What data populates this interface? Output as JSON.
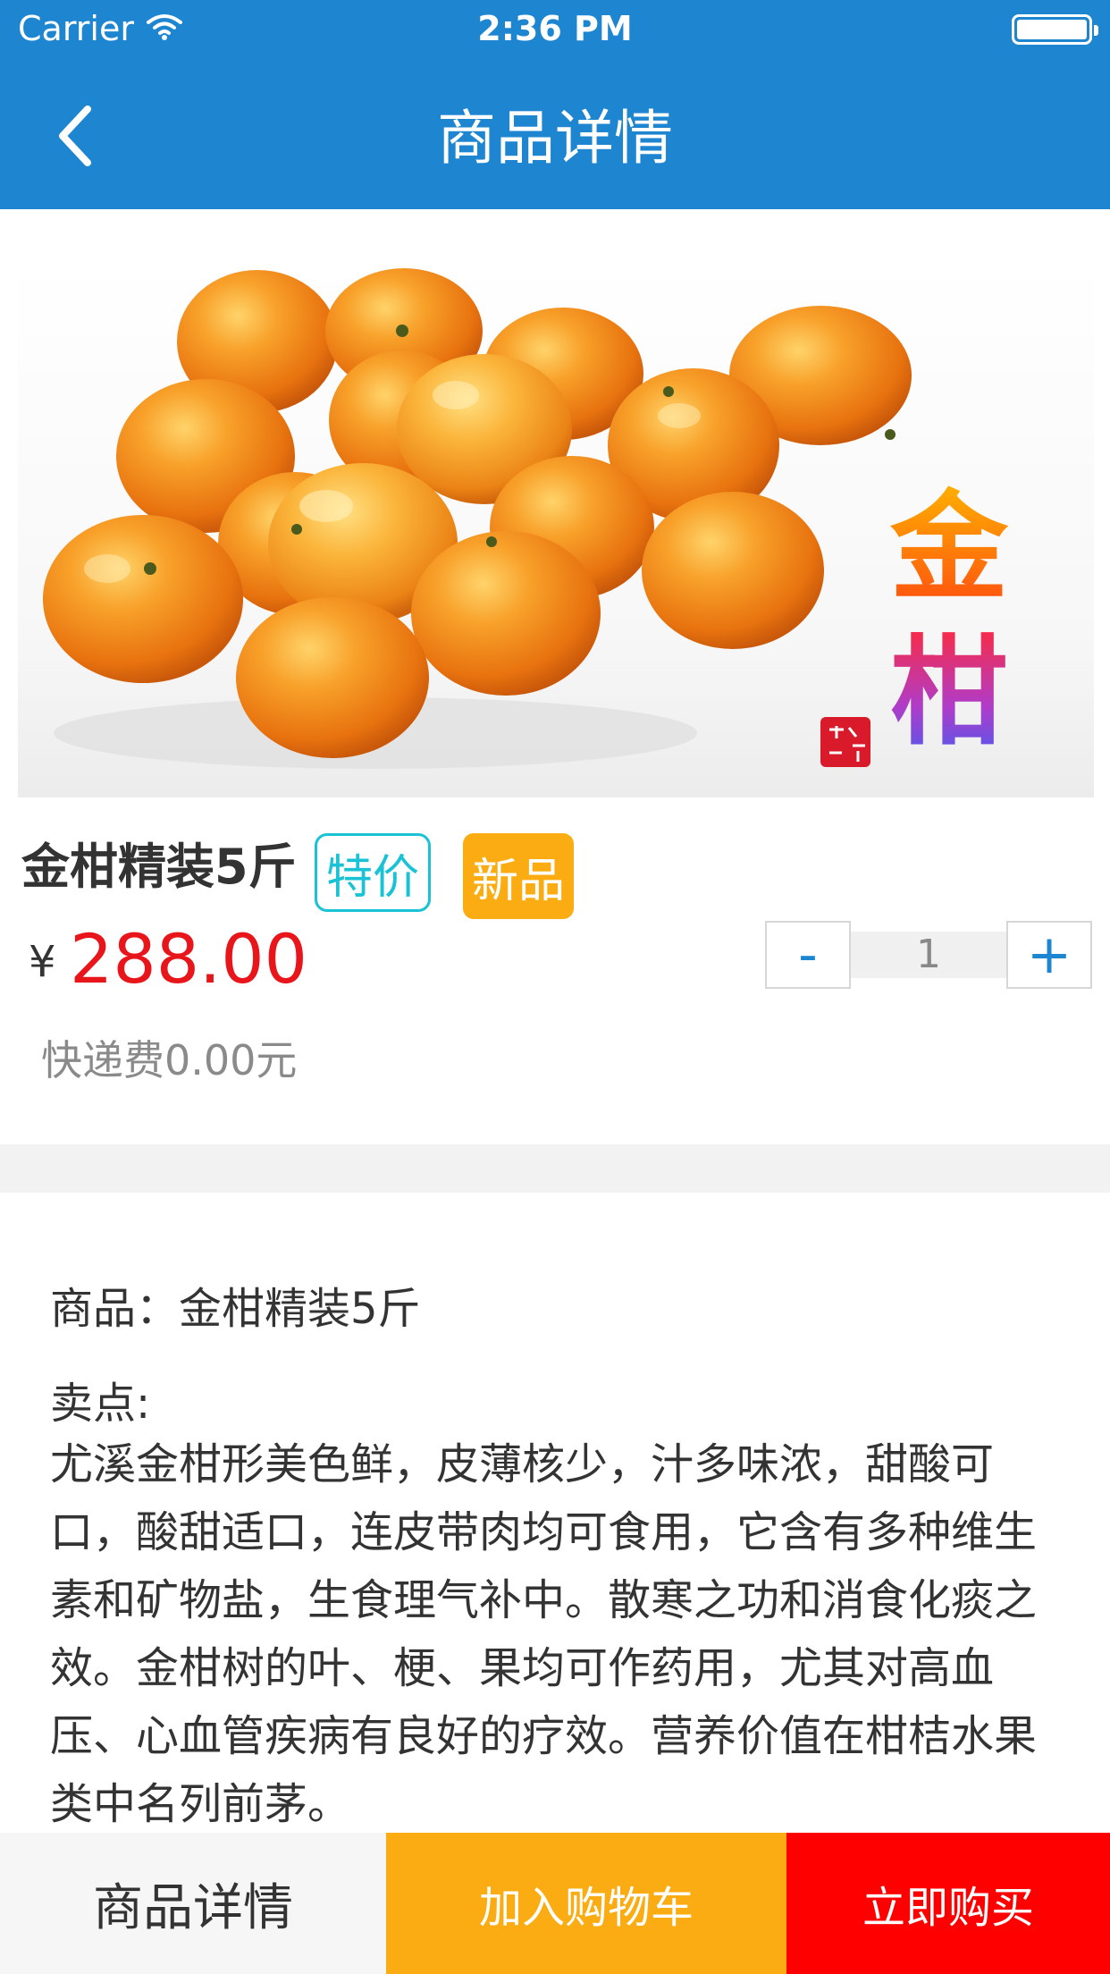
{
  "status_bar": {
    "carrier": "Carrier",
    "time": "2:36 PM",
    "icons": [
      "wifi-icon",
      "battery-icon"
    ]
  },
  "nav": {
    "title": "商品详情",
    "back_icon": "chevron-left-icon"
  },
  "product": {
    "image_title": "金柑",
    "name": "金柑精装5斤",
    "tags": [
      "特价",
      "新品"
    ],
    "currency": "¥",
    "price": "288.00",
    "shipping": "快递费0.00元"
  },
  "quantity": {
    "minus": "-",
    "value": "1",
    "plus": "+"
  },
  "description": {
    "name_line": "商品：金柑精装5斤",
    "label": "卖点:",
    "text": "尤溪金柑形美色鲜，皮薄核少，汁多味浓，甜酸可口，酸甜适口，连皮带肉均可食用，它含有多种维生素和矿物盐，生食理气补中。散寒之功和消食化痰之效。金柑树的叶、梗、果均可作药用，尤其对高血压、心血管疾病有良好的疗效。营养价值在柑桔水果类中名列前茅。"
  },
  "bottom_bar": {
    "detail": "商品详情",
    "add_to_cart": "加入购物车",
    "buy_now": "立即购买"
  },
  "colors": {
    "primary": "#1e85d1",
    "price": "#e8161b",
    "tag_special": "#19c2d4",
    "tag_new": "#fbac12",
    "cart": "#fbac12",
    "buy": "#fe0000"
  }
}
